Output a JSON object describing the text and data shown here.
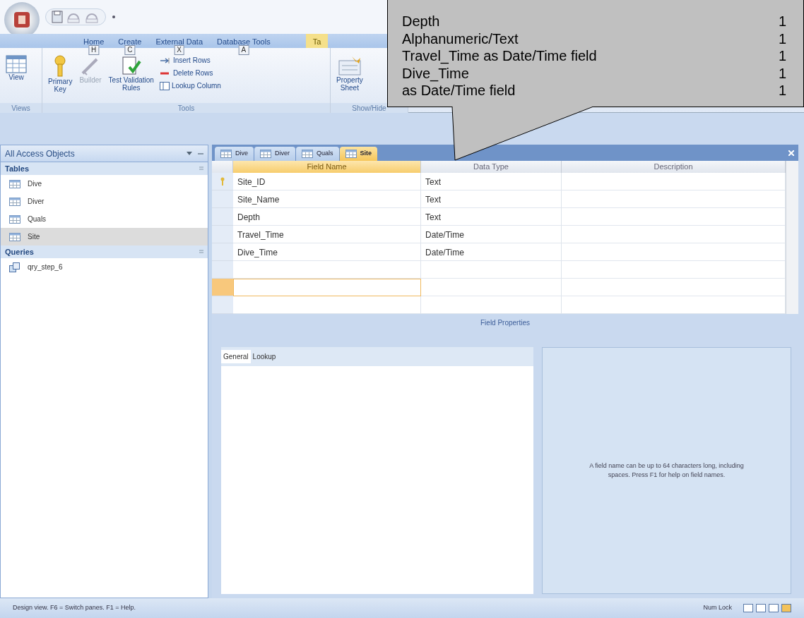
{
  "ribbon_tabs": [
    {
      "label": "Home",
      "key_tip": "H",
      "kind": "normal"
    },
    {
      "label": "Create",
      "key_tip": "C",
      "kind": "normal"
    },
    {
      "label": "External Data",
      "key_tip": "X",
      "kind": "normal"
    },
    {
      "label": "Database Tools",
      "key_tip": "A",
      "kind": "normal"
    },
    {
      "label": "Ta",
      "kind": "contextual"
    }
  ],
  "ribbon_groups": [
    {
      "label": "Views",
      "buttons": [
        {
          "label": "View",
          "kind": "large",
          "disabled": false
        }
      ]
    },
    {
      "label": "Tools",
      "buttons": [
        {
          "label": "Primary\nKey",
          "kind": "large",
          "disabled": false
        },
        {
          "label": "Builder",
          "kind": "large",
          "disabled": true
        },
        {
          "label": "Test Validation\nRules",
          "kind": "large",
          "disabled": false
        },
        {
          "label": "Insert Rows",
          "kind": "small",
          "disabled": false
        },
        {
          "label": "Delete Rows",
          "kind": "small",
          "disabled": false
        },
        {
          "label": "Lookup Column",
          "kind": "small",
          "disabled": false
        }
      ]
    },
    {
      "label": "Show/Hide",
      "buttons": [
        {
          "label": "Property\nSheet",
          "kind": "large",
          "disabled": false
        }
      ]
    }
  ],
  "callout": {
    "lines": [
      {
        "text": "Depth",
        "value": "1"
      },
      {
        "text": "Alphanumeric/Text",
        "value": "1"
      },
      {
        "text": "Travel_Time as Date/Time field",
        "value": "1"
      },
      {
        "text": "Dive_Time",
        "value": "1"
      },
      {
        "text": "as Date/Time field",
        "value": "1"
      }
    ]
  },
  "navigation_pane": {
    "title": "All Access Objects",
    "sections": [
      {
        "title": "Tables",
        "items": [
          {
            "label": "Dive",
            "kind": "table",
            "selected": false
          },
          {
            "label": "Diver",
            "kind": "table",
            "selected": false
          },
          {
            "label": "Quals",
            "kind": "table",
            "selected": false
          },
          {
            "label": "Site",
            "kind": "table",
            "selected": true
          }
        ]
      },
      {
        "title": "Queries",
        "items": [
          {
            "label": "qry_step_6",
            "kind": "query",
            "selected": false
          }
        ]
      }
    ]
  },
  "document_tabs": [
    {
      "label": "Dive",
      "selected": false
    },
    {
      "label": "Diver",
      "selected": false
    },
    {
      "label": "Quals",
      "selected": false
    },
    {
      "label": "Site",
      "selected": true
    }
  ],
  "table": {
    "columns": [
      "Field Name",
      "Data Type",
      "Description"
    ],
    "rows": [
      {
        "field_name": "Site_ID",
        "data_type": "Text",
        "primary_key": true,
        "selected": false
      },
      {
        "field_name": "Site_Name",
        "data_type": "Text",
        "primary_key": false,
        "selected": false
      },
      {
        "field_name": "Depth",
        "data_type": "Text",
        "primary_key": false,
        "selected": false
      },
      {
        "field_name": "Travel_Time",
        "data_type": "Date/Time",
        "primary_key": false,
        "selected": false
      },
      {
        "field_name": "Dive_Time",
        "data_type": "Date/Time",
        "primary_key": false,
        "selected": false
      },
      {
        "primary_key": false,
        "selected": false
      },
      {
        "primary_key": false,
        "selected": true
      },
      {
        "primary_key": false,
        "selected": false
      }
    ]
  },
  "field_properties": {
    "title": "Field Properties",
    "tabs": [
      {
        "label": "General",
        "selected": true
      },
      {
        "label": "Lookup",
        "selected": false
      }
    ],
    "help_text": "A field name can be up to 64 characters long, including spaces.  Press F1 for help on field names."
  },
  "status_bar": {
    "text": "Design view.  F6 = Switch panes.  F1 = Help.",
    "indicator": "Num Lock"
  }
}
